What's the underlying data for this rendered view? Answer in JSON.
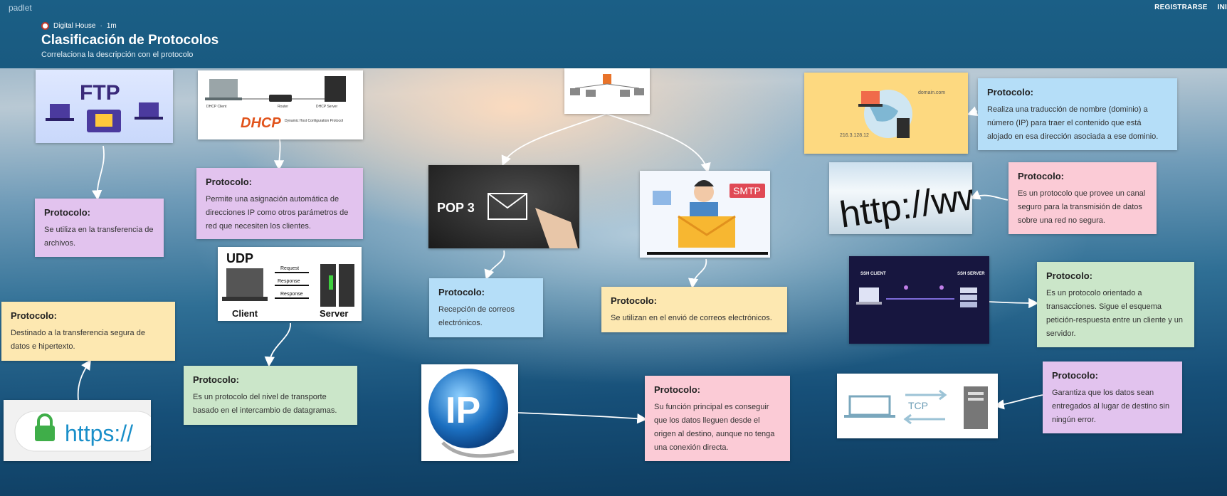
{
  "app": {
    "brand": "padlet",
    "register": "REGISTRARSE",
    "login": "INI"
  },
  "header": {
    "author": "Digital House",
    "time": "1m",
    "title": "Clasificación de Protocolos",
    "subtitle": "Correlaciona la descripción con el protocolo"
  },
  "images": {
    "ftp": "FTP",
    "dhcp": "DHCP",
    "dhcp_sub": "Dynamic Host Configuration Protocol",
    "dhcp_client": "DHCP Client",
    "dhcp_router": "Router",
    "dhcp_server": "DHCP Server",
    "udp": "UDP",
    "udp_request": "Request",
    "udp_response1": "Response",
    "udp_response2": "Response",
    "udp_client": "Client",
    "udp_server": "Server",
    "https": "https://",
    "pop3": "POP 3",
    "smtp": "SMTP",
    "ip": "IP",
    "dns_domain": "domain.com",
    "dns_ip": "216.3.128.12",
    "http": "http://ww",
    "ssh_client": "SSH CLIENT",
    "ssh_server": "SSH SERVER",
    "tcp": "TCP"
  },
  "cards": {
    "label": "Protocolo:",
    "c1": "Se utiliza en la transferencia de archivos.",
    "c2": "Permite una asignación automática de direcciones IP como otros parámetros de red que necesiten los clientes.",
    "c3": "Destinado a la transferencia segura de datos e hipertexto.",
    "c4": "Es un protocolo del nivel de transporte basado en el intercambio de datagramas.",
    "c5": "Recepción de correos electrónicos.",
    "c6": "Se utilizan en el envió de correos electrónicos.",
    "c7": "Su función principal es conseguir que los datos lleguen desde el origen al destino, aunque no tenga una conexión directa.",
    "c8": "Realiza una traducción de nombre (dominio) a número (IP) para traer el contenido que está alojado en esa dirección asociada a ese dominio.",
    "c9": "Es un protocolo que provee un canal seguro para la transmisión de datos sobre una red no segura.",
    "c10": "Es un protocolo orientado a transacciones. Sigue el esquema petición-respuesta entre un cliente y un servidor.",
    "c11": "Garantiza que los datos sean entregados al lugar de destino sin ningún error."
  },
  "colors": {
    "header": "#1b5f86",
    "purple": "#e2c3ee",
    "pink": "#fbcbd6",
    "yellow": "#fde8b1",
    "green": "#cbe6c9",
    "blue": "#b5def8"
  }
}
